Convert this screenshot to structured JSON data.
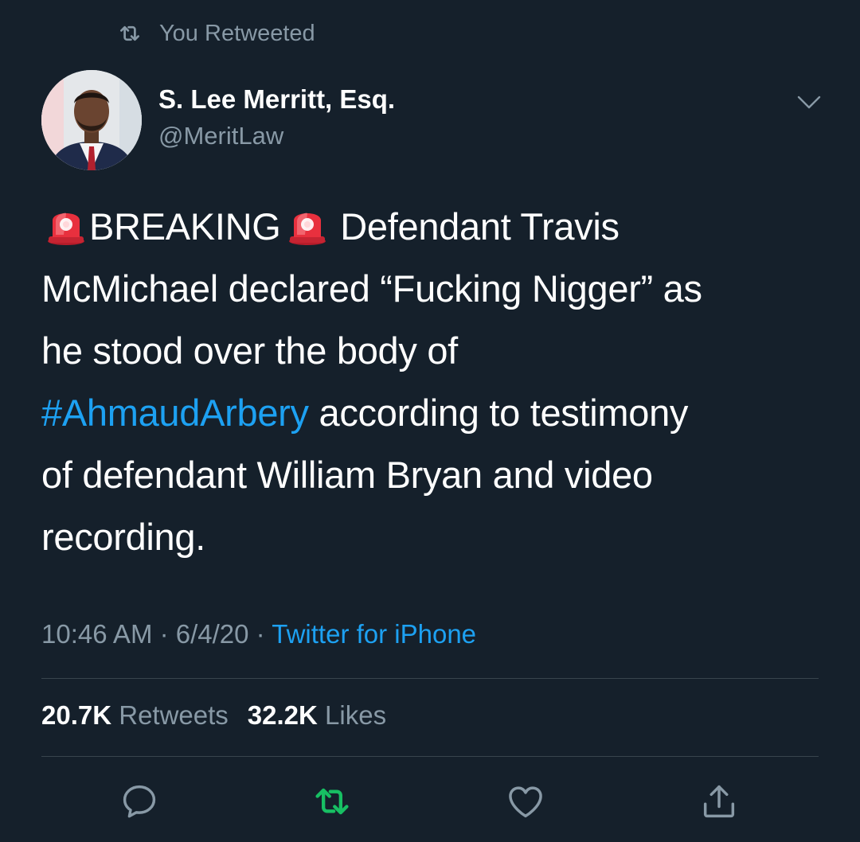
{
  "retweet_banner": {
    "text": "You Retweeted",
    "icon": "retweet-icon"
  },
  "author": {
    "display_name": "S. Lee Merritt, Esq.",
    "handle": "@MeritLaw",
    "avatar": "profile-photo"
  },
  "tweet": {
    "emoji": "police-light-emoji",
    "breaking": "BREAKING",
    "line1_rest": " Defendant Travis",
    "line2": "McMichael declared “Fucking Nigger” as",
    "line3": "he stood over the body of",
    "hashtag": "#AhmaudArbery",
    "line4_rest": " according to testimony",
    "line5": "of defendant William Bryan and video",
    "line6": "recording."
  },
  "meta": {
    "time": "10:46 AM",
    "separator": " · ",
    "date": "6/4/20",
    "source": "Twitter for iPhone"
  },
  "stats": {
    "retweets_count": "20.7K",
    "retweets_label": "Retweets",
    "likes_count": "32.2K",
    "likes_label": "Likes"
  },
  "colors": {
    "background": "#15202b",
    "text_primary": "#ffffff",
    "text_secondary": "#8899a6",
    "link": "#1da1f2",
    "retweet_active": "#17bf63",
    "divider": "#38444d"
  },
  "actions": {
    "reply": "reply-icon",
    "retweet": "retweet-icon",
    "like": "heart-icon",
    "share": "share-icon"
  }
}
